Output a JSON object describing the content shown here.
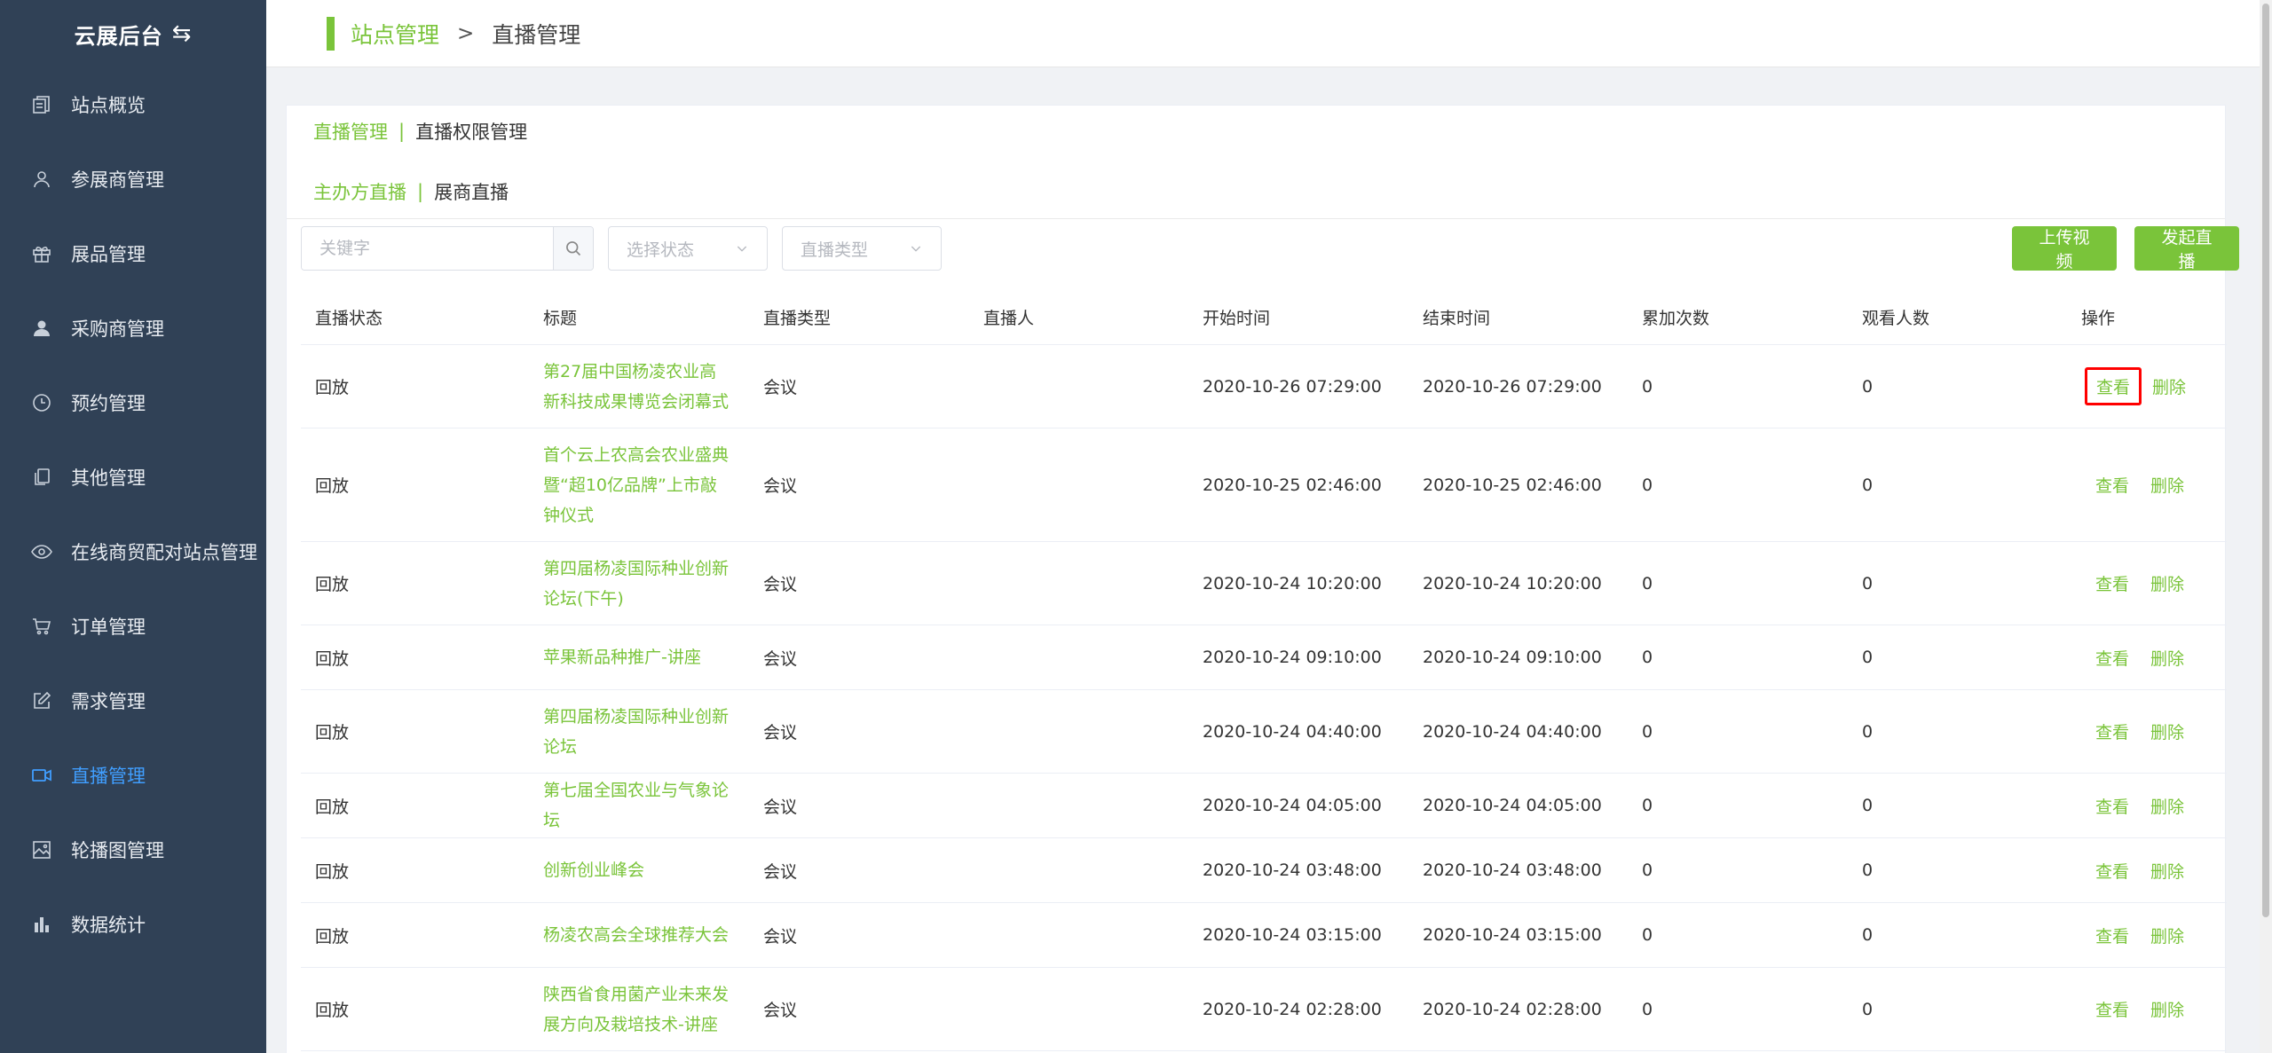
{
  "brand": {
    "title": "云展后台",
    "swap_icon": "swap-icon"
  },
  "sidebar": {
    "items": [
      {
        "label": "站点概览",
        "icon": "overview-icon",
        "active": false
      },
      {
        "label": "参展商管理",
        "icon": "user-outline-icon",
        "active": false
      },
      {
        "label": "展品管理",
        "icon": "gift-icon",
        "active": false
      },
      {
        "label": "采购商管理",
        "icon": "user-solid-icon",
        "active": false
      },
      {
        "label": "预约管理",
        "icon": "clock-icon",
        "active": false
      },
      {
        "label": "其他管理",
        "icon": "copy-icon",
        "active": false
      },
      {
        "label": "在线商贸配对站点管理",
        "icon": "eye-icon",
        "active": false
      },
      {
        "label": "订单管理",
        "icon": "cart-icon",
        "active": false
      },
      {
        "label": "需求管理",
        "icon": "edit-icon",
        "active": false
      },
      {
        "label": "直播管理",
        "icon": "video-camera-icon",
        "active": true
      },
      {
        "label": "轮播图管理",
        "icon": "picture-icon",
        "active": false
      },
      {
        "label": "数据统计",
        "icon": "bar-chart-icon",
        "active": false
      }
    ]
  },
  "header": {
    "crumb1": "站点管理",
    "separator": ">",
    "crumb2": "直播管理"
  },
  "tabs_primary": {
    "active": "直播管理",
    "divider": "|",
    "other": "直播权限管理"
  },
  "tabs_secondary": {
    "active": "主办方直播",
    "divider": "|",
    "other": "展商直播"
  },
  "toolbar": {
    "search_placeholder": "关键字",
    "status_placeholder": "选择状态",
    "type_placeholder": "直播类型",
    "upload_label": "上传视频",
    "start_label": "发起直播"
  },
  "table": {
    "headers": [
      "直播状态",
      "标题",
      "直播类型",
      "直播人",
      "开始时间",
      "结束时间",
      "累加次数",
      "观看人数",
      "操作"
    ],
    "view_label": "查看",
    "delete_label": "删除",
    "rows": [
      {
        "status": "回放",
        "title": "第27届中国杨凌农业高新科技成果博览会闭幕式",
        "type": "会议",
        "host": "",
        "start": "2020-10-26 07:29:00",
        "end": "2020-10-26 07:29:00",
        "count": "0",
        "viewers": "0"
      },
      {
        "status": "回放",
        "title": "首个云上农高会农业盛典暨“超10亿品牌”上市敲钟仪式",
        "type": "会议",
        "host": "",
        "start": "2020-10-25 02:46:00",
        "end": "2020-10-25 02:46:00",
        "count": "0",
        "viewers": "0"
      },
      {
        "status": "回放",
        "title": "第四届杨凌国际种业创新论坛(下午)",
        "type": "会议",
        "host": "",
        "start": "2020-10-24 10:20:00",
        "end": "2020-10-24 10:20:00",
        "count": "0",
        "viewers": "0"
      },
      {
        "status": "回放",
        "title": "苹果新品种推广-讲座",
        "type": "会议",
        "host": "",
        "start": "2020-10-24 09:10:00",
        "end": "2020-10-24 09:10:00",
        "count": "0",
        "viewers": "0"
      },
      {
        "status": "回放",
        "title": "第四届杨凌国际种业创新论坛",
        "type": "会议",
        "host": "",
        "start": "2020-10-24 04:40:00",
        "end": "2020-10-24 04:40:00",
        "count": "0",
        "viewers": "0"
      },
      {
        "status": "回放",
        "title": "第七届全国农业与气象论坛",
        "type": "会议",
        "host": "",
        "start": "2020-10-24 04:05:00",
        "end": "2020-10-24 04:05:00",
        "count": "0",
        "viewers": "0"
      },
      {
        "status": "回放",
        "title": "创新创业峰会",
        "type": "会议",
        "host": "",
        "start": "2020-10-24 03:48:00",
        "end": "2020-10-24 03:48:00",
        "count": "0",
        "viewers": "0"
      },
      {
        "status": "回放",
        "title": "杨凌农高会全球推荐大会",
        "type": "会议",
        "host": "",
        "start": "2020-10-24 03:15:00",
        "end": "2020-10-24 03:15:00",
        "count": "0",
        "viewers": "0"
      },
      {
        "status": "回放",
        "title": "陕西省食用菌产业未来发展方向及栽培技术-讲座",
        "type": "会议",
        "host": "",
        "start": "2020-10-24 02:28:00",
        "end": "2020-10-24 02:28:00",
        "count": "0",
        "viewers": "0"
      }
    ]
  },
  "colors": {
    "sidebar_bg": "#304156",
    "accent_green": "#7ac43a",
    "active_blue": "#409eff",
    "highlight_red": "#ff0000"
  }
}
